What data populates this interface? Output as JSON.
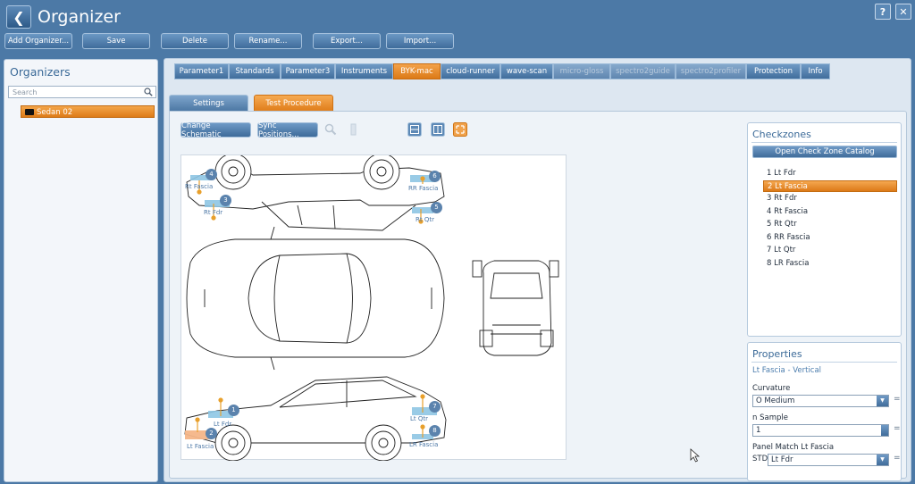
{
  "window": {
    "title": "Organizer",
    "help_label": "?",
    "close_label": "✕"
  },
  "toolbar": {
    "add_organizer": "Add Organizer...",
    "save": "Save",
    "delete": "Delete",
    "rename": "Rename...",
    "export": "Export...",
    "import": "Import..."
  },
  "left_panel": {
    "title": "Organizers",
    "search_placeholder": "Search",
    "items": [
      {
        "label": "Sedan 02"
      }
    ]
  },
  "tabs": [
    {
      "label": "Parameter1",
      "state": "normal"
    },
    {
      "label": "Standards",
      "state": "normal"
    },
    {
      "label": "Parameter3",
      "state": "normal"
    },
    {
      "label": "Instruments",
      "state": "normal"
    },
    {
      "label": "BYK-mac",
      "state": "active"
    },
    {
      "label": "cloud-runner",
      "state": "normal"
    },
    {
      "label": "wave-scan",
      "state": "normal"
    },
    {
      "label": "micro-gloss",
      "state": "disabled"
    },
    {
      "label": "spectro2guide",
      "state": "disabled"
    },
    {
      "label": "spectro2profiler",
      "state": "disabled"
    },
    {
      "label": "Protection",
      "state": "normal"
    },
    {
      "label": "Info",
      "state": "normal"
    }
  ],
  "subtabs": [
    {
      "label": "Settings",
      "state": "normal"
    },
    {
      "label": "Test Procedure",
      "state": "active"
    }
  ],
  "actions": {
    "change_schematic": "Change Schematic",
    "sync_positions": "Sync Positions..."
  },
  "schematic_markers": [
    {
      "number": "4",
      "label": "Rt Fascia"
    },
    {
      "number": "3",
      "label": "Rt Fdr"
    },
    {
      "number": "6",
      "label": "RR Fascia"
    },
    {
      "number": "5",
      "label": "Rt Qtr"
    },
    {
      "number": "1",
      "label": "Lt Fdr"
    },
    {
      "number": "2",
      "label": "Lt Fascia"
    },
    {
      "number": "7",
      "label": "Lt Qtr"
    },
    {
      "number": "8",
      "label": "LR Fascia"
    }
  ],
  "checkzones": {
    "title": "Checkzones",
    "catalog_button": "Open Check Zone Catalog",
    "selected_index": 1,
    "items": [
      {
        "text": "1   Lt Fdr"
      },
      {
        "text": "2   Lt Fascia"
      },
      {
        "text": "3   Rt Fdr"
      },
      {
        "text": "4   Rt Fascia"
      },
      {
        "text": "5   Rt Qtr"
      },
      {
        "text": "6   RR Fascia"
      },
      {
        "text": "7   Lt Qtr"
      },
      {
        "text": "8   LR Fascia"
      }
    ]
  },
  "properties": {
    "title": "Properties",
    "subtitle": "Lt Fascia - Vertical",
    "curvature_label": "Curvature",
    "curvature_value": "O Medium",
    "n_sample_label": "n Sample",
    "n_sample_value": "1",
    "panel_match_label": "Panel Match Lt Fascia",
    "std_label": "STD",
    "std_value": "Lt Fdr",
    "eq": "="
  },
  "colors": {
    "accent_orange": "#e58a24",
    "primary_blue": "#4c79a6",
    "marker_blue": "#5b83ad",
    "zone_cyan": "#8ec6e4"
  }
}
